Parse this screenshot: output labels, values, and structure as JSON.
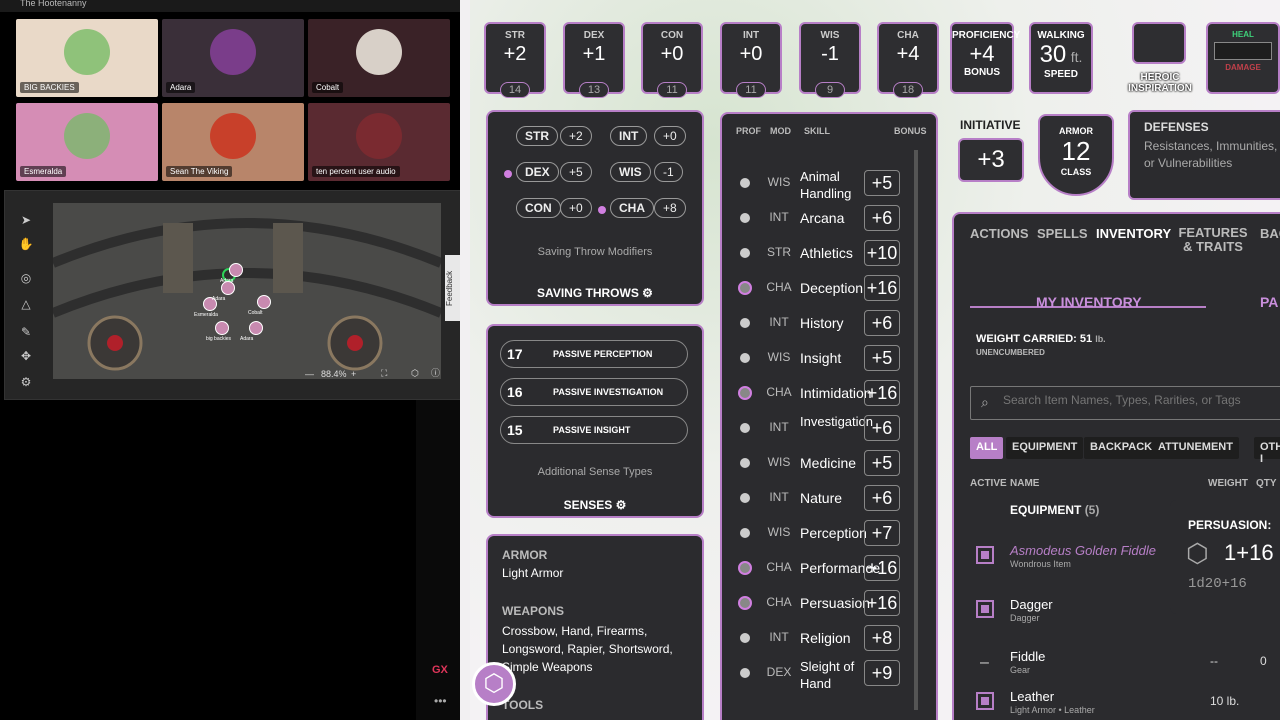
{
  "window": {
    "title": "The Hootenanny"
  },
  "participants": [
    {
      "name": "BIG BACKIES",
      "bg": "#e9d9c8"
    },
    {
      "name": "Adara",
      "bg": "#3a2f39"
    },
    {
      "name": "Cobalt",
      "bg": "#3a2227"
    },
    {
      "name": "Esmeralda",
      "bg": "#d58db5"
    },
    {
      "name": "Sean The Viking",
      "bg": "#b8856a"
    },
    {
      "name": "ten percent user audio",
      "bg": "#5a2a31"
    }
  ],
  "map": {
    "zoom": "88.4%",
    "feedback": "Feedback",
    "tokens": [
      "Esmeralda",
      "Adara",
      "Cobalt",
      "big backies",
      "Adara",
      "Adara"
    ]
  },
  "gx": "GX",
  "abilities": [
    {
      "label": "STR",
      "mod": "+2",
      "score": "14"
    },
    {
      "label": "DEX",
      "mod": "+1",
      "score": "13"
    },
    {
      "label": "CON",
      "mod": "+0",
      "score": "11"
    },
    {
      "label": "INT",
      "mod": "+0",
      "score": "11"
    },
    {
      "label": "WIS",
      "mod": "-1",
      "score": "9"
    },
    {
      "label": "CHA",
      "mod": "+4",
      "score": "18"
    }
  ],
  "proficiency": {
    "label": "PROFICIENCY",
    "value": "+4",
    "sub": "BONUS"
  },
  "walking": {
    "label": "WALKING",
    "value": "30",
    "unit": "ft.",
    "sub": "SPEED"
  },
  "heroic": {
    "label": "HEROIC",
    "label2": "INSPIRATION"
  },
  "hp": {
    "heal": "HEAL",
    "damage": "DAMAGE"
  },
  "initiative": {
    "label": "INITIATIVE",
    "value": "+3"
  },
  "armor": {
    "label": "ARMOR",
    "value": "12",
    "sub": "CLASS"
  },
  "defenses": {
    "title": "DEFENSES",
    "text": "Resistances, Immunities, or Vulnerabilities"
  },
  "saves": [
    {
      "ab": "STR",
      "val": "+2",
      "prof": false
    },
    {
      "ab": "INT",
      "val": "+0",
      "prof": false
    },
    {
      "ab": "DEX",
      "val": "+5",
      "prof": true
    },
    {
      "ab": "WIS",
      "val": "-1",
      "prof": false
    },
    {
      "ab": "CON",
      "val": "+0",
      "prof": false
    },
    {
      "ab": "CHA",
      "val": "+8",
      "prof": true
    }
  ],
  "saving_throws": {
    "modifiers": "Saving Throw Modifiers",
    "title": "SAVING THROWS"
  },
  "senses": {
    "items": [
      {
        "n": "17",
        "t": "PASSIVE PERCEPTION"
      },
      {
        "n": "16",
        "t": "PASSIVE INVESTIGATION"
      },
      {
        "n": "15",
        "t": "PASSIVE INSIGHT"
      }
    ],
    "extra": "Additional Sense Types",
    "title": "SENSES"
  },
  "profs": {
    "armor_title": "ARMOR",
    "armor": "Light Armor",
    "weapons_title": "WEAPONS",
    "weapons": "Crossbow, Hand, Firearms, Longsword, Rapier, Shortsword, Simple Weapons",
    "tools_title": "TOOLS"
  },
  "skills_header": {
    "prof": "PROF",
    "mod": "MOD",
    "skill": "SKILL",
    "bonus": "BONUS"
  },
  "skills": [
    {
      "ab": "WIS",
      "name": "Animal Handling",
      "bonus": "+5",
      "exp": false
    },
    {
      "ab": "INT",
      "name": "Arcana",
      "bonus": "+6",
      "exp": false
    },
    {
      "ab": "STR",
      "name": "Athletics",
      "bonus": "+10",
      "exp": false
    },
    {
      "ab": "CHA",
      "name": "Deception",
      "bonus": "+16",
      "exp": true
    },
    {
      "ab": "INT",
      "name": "History",
      "bonus": "+6",
      "exp": false
    },
    {
      "ab": "WIS",
      "name": "Insight",
      "bonus": "+5",
      "exp": false
    },
    {
      "ab": "CHA",
      "name": "Intimidation",
      "bonus": "+16",
      "exp": true
    },
    {
      "ab": "INT",
      "name": "Investigation",
      "bonus": "+6",
      "exp": false
    },
    {
      "ab": "WIS",
      "name": "Medicine",
      "bonus": "+5",
      "exp": false
    },
    {
      "ab": "INT",
      "name": "Nature",
      "bonus": "+6",
      "exp": false
    },
    {
      "ab": "WIS",
      "name": "Perception",
      "bonus": "+7",
      "exp": false
    },
    {
      "ab": "CHA",
      "name": "Performance",
      "bonus": "+16",
      "exp": true
    },
    {
      "ab": "CHA",
      "name": "Persuasion",
      "bonus": "+16",
      "exp": true
    },
    {
      "ab": "INT",
      "name": "Religion",
      "bonus": "+8",
      "exp": false
    },
    {
      "ab": "DEX",
      "name": "Sleight of Hand",
      "bonus": "+9",
      "exp": false
    }
  ],
  "tabs": [
    "ACTIONS",
    "SPELLS",
    "INVENTORY",
    "FEATURES & TRAITS",
    "BACK"
  ],
  "inventory": {
    "title": "MY INVENTORY",
    "title2": "PA",
    "weight": "WEIGHT CARRIED: 51",
    "weight_unit": "lb.",
    "status": "UNENCUMBERED",
    "search_placeholder": "Search Item Names, Types, Rarities, or Tags",
    "filters": [
      "ALL",
      "EQUIPMENT",
      "BACKPACK",
      "ATTUNEMENT",
      "OTHER I"
    ],
    "col_active": "ACTIVE",
    "col_name": "NAME",
    "col_weight": "WEIGHT",
    "col_qty": "QTY",
    "group": "EQUIPMENT",
    "group_count": "(5)",
    "items": [
      {
        "name": "Asmodeus Golden Fiddle",
        "sub": "Wondrous Item",
        "weight": "",
        "qty": "",
        "magic": true,
        "active": true
      },
      {
        "name": "Dagger",
        "sub": "Dagger",
        "weight": "",
        "qty": "",
        "magic": false,
        "active": true
      },
      {
        "name": "Fiddle",
        "sub": "Gear",
        "weight": "--",
        "qty": "0",
        "magic": false,
        "active": false
      },
      {
        "name": "Leather",
        "sub": "Light Armor • Leather",
        "weight": "10 lb.",
        "qty": "",
        "magic": false,
        "active": true
      }
    ]
  },
  "roll": {
    "label": "PERSUASION:",
    "result": "1+16",
    "formula": "1d20+16"
  },
  "colors": {
    "accent": "#b77fc7",
    "card": "#2b2b2e",
    "magic": "#b77fc7"
  }
}
